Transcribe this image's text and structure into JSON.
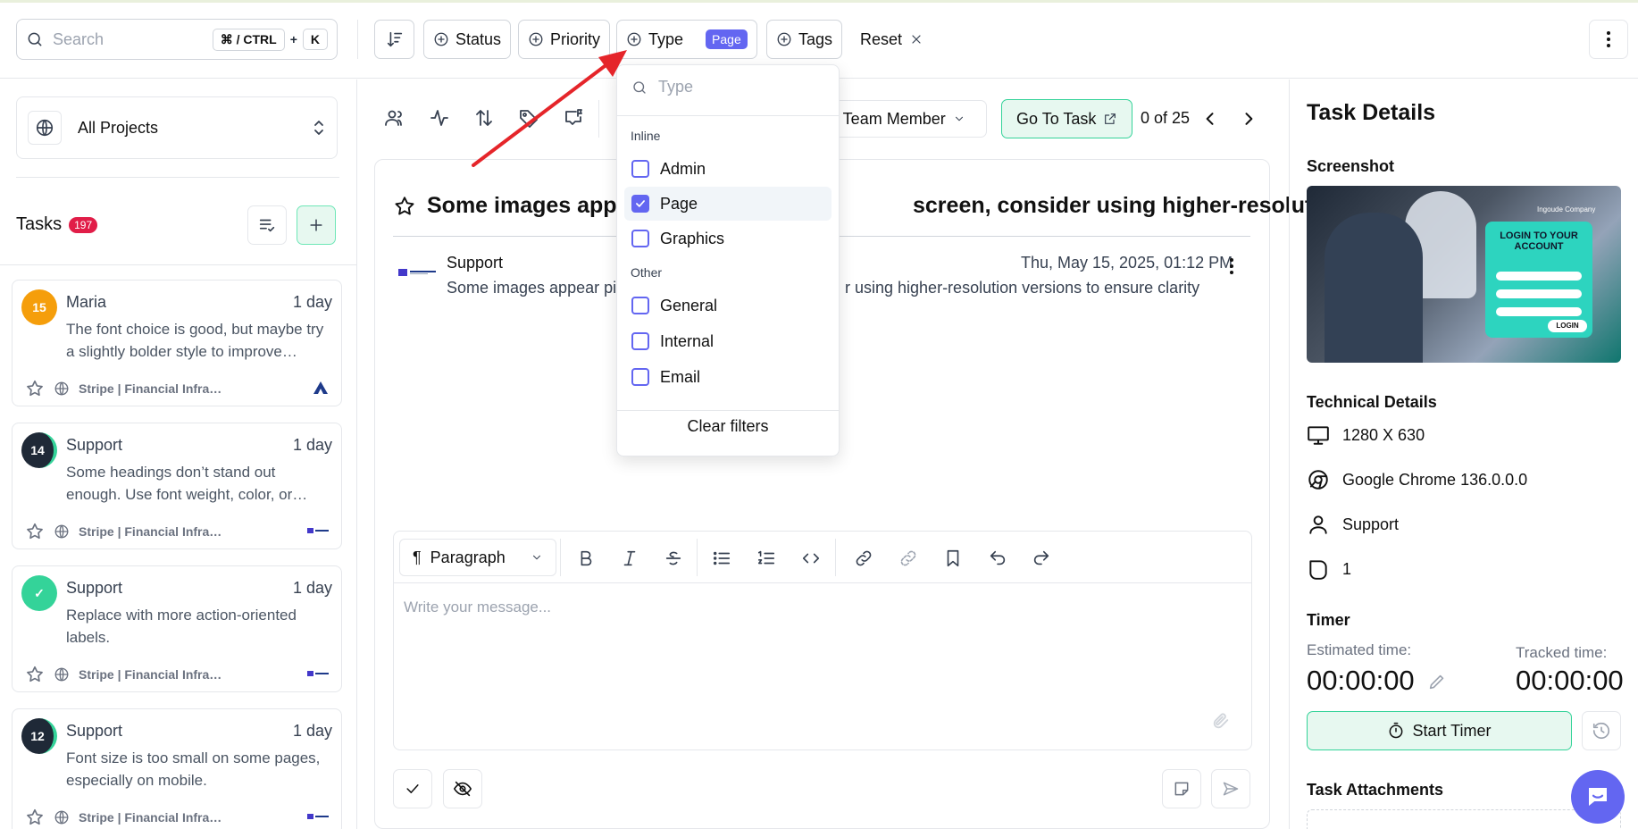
{
  "topbar": {
    "search_placeholder": "Search",
    "shortcut_key1": "⌘ / CTRL",
    "shortcut_plus": "+",
    "shortcut_key2": "K",
    "filters": {
      "status": "Status",
      "priority": "Priority",
      "type": "Type",
      "type_badge": "Page",
      "tags": "Tags",
      "reset": "Reset"
    }
  },
  "sidebar": {
    "project_select": "All Projects",
    "tasks_label": "Tasks",
    "tasks_count": "197",
    "tasks": [
      {
        "avatar_text": "15",
        "avatar_color": "#f59e0b",
        "name": "Maria",
        "ago": "1 day",
        "text": "The font choice is good, but maybe try a slightly bolder style to improve…",
        "project": "Stripe | Financial Infra…"
      },
      {
        "avatar_text": "14",
        "avatar_color": "#1f2937",
        "name": "Support",
        "ago": "1 day",
        "text": "Some headings don’t stand out enough. Use font weight, color, or…",
        "project": "Stripe | Financial Infra…"
      },
      {
        "avatar_text": "✓",
        "avatar_color": "#34d399",
        "name": "Support",
        "ago": "1 day",
        "text": "Replace with more action-oriented labels.",
        "project": "Stripe | Financial Infra…"
      },
      {
        "avatar_text": "12",
        "avatar_color": "#1f2937",
        "name": "Support",
        "ago": "1 day",
        "text": "Font size is too small on some pages, especially on mobile.",
        "project": "Stripe | Financial Infra…"
      }
    ]
  },
  "main": {
    "member_select": "n Team Member",
    "goto_label": "Go To Task",
    "pager": "0 of 25",
    "title_left": "Some images appe",
    "title_right": "screen, consider using higher-resoluti…",
    "comment": {
      "author": "Support",
      "date": "Thu, May 15, 2025, 01:12 PM",
      "text_left": "Some images appear pix",
      "text_right": "r using higher-resolution versions to ensure clarity"
    },
    "editor": {
      "block_type": "Paragraph",
      "placeholder": "Write your message..."
    }
  },
  "dropdown": {
    "search_placeholder": "Type",
    "groups": [
      {
        "label": "Inline",
        "items": [
          {
            "label": "Admin",
            "checked": false
          },
          {
            "label": "Page",
            "checked": true
          },
          {
            "label": "Graphics",
            "checked": false
          }
        ]
      },
      {
        "label": "Other",
        "items": [
          {
            "label": "General",
            "checked": false
          },
          {
            "label": "Internal",
            "checked": false
          },
          {
            "label": "Email",
            "checked": false
          }
        ]
      }
    ],
    "clear_label": "Clear filters"
  },
  "details": {
    "title": "Task Details",
    "screenshot_label": "Screenshot",
    "screenshot_text": {
      "brand": "Ingoude Company",
      "heading": "LOGIN TO YOUR ACCOUNT",
      "button": "LOGIN"
    },
    "technical_label": "Technical Details",
    "resolution": "1280 X 630",
    "browser": "Google Chrome 136.0.0.0",
    "user": "Support",
    "count": "1",
    "timer_label": "Timer",
    "estimated_label": "Estimated time:",
    "estimated_value": "00:00:00",
    "tracked_label": "Tracked time:",
    "tracked_value": "00:00:00",
    "start_timer": "Start Timer",
    "attachments_label": "Task Attachments"
  },
  "colors": {
    "accent": "#6366f1",
    "green_accent": "#34d399",
    "count_badge": "#e11d48",
    "annotation_arrow": "#e5252a"
  }
}
